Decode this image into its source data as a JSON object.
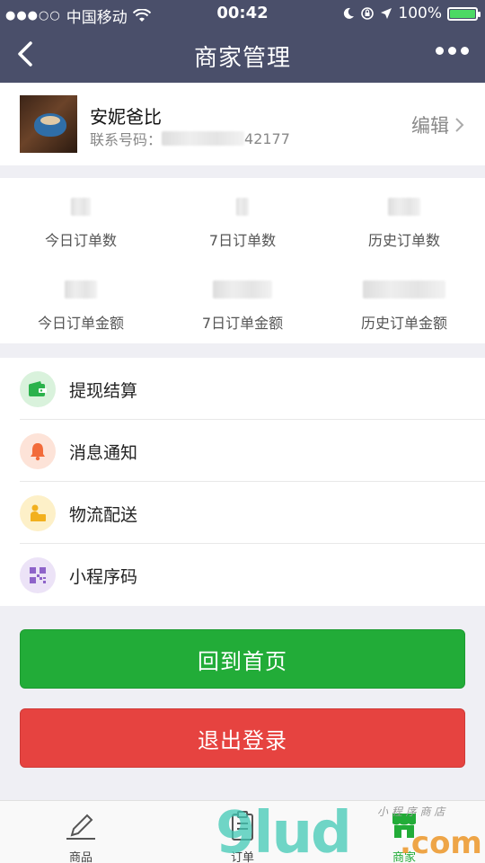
{
  "status_bar": {
    "carrier": "中国移动",
    "time": "00:42",
    "battery": "100%",
    "battery_level": 1.0
  },
  "nav": {
    "title": "商家管理"
  },
  "profile": {
    "name": "安妮爸比",
    "phone_label": "联系号码：",
    "phone_suffix": "42177",
    "edit_label": "编辑"
  },
  "stats": [
    {
      "label": "今日订单数"
    },
    {
      "label": "7日订单数"
    },
    {
      "label": "历史订单数"
    },
    {
      "label": "今日订单金额"
    },
    {
      "label": "7日订单金额"
    },
    {
      "label": "历史订单金额"
    }
  ],
  "menu": [
    {
      "label": "提现结算",
      "icon": "wallet-icon",
      "color": "#2bb24c",
      "bg": "#d9f2dc"
    },
    {
      "label": "消息通知",
      "icon": "bell-icon",
      "color": "#f26b3a",
      "bg": "#fde3d8"
    },
    {
      "label": "物流配送",
      "icon": "delivery-icon",
      "color": "#f2b01e",
      "bg": "#fdf0c8"
    },
    {
      "label": "小程序码",
      "icon": "qrcode-icon",
      "color": "#8e63c9",
      "bg": "#ece3f7"
    }
  ],
  "buttons": {
    "home": "回到首页",
    "logout": "退出登录"
  },
  "tabbar": [
    {
      "label": "商品",
      "icon": "pencil-icon"
    },
    {
      "label": "订单",
      "icon": "clipboard-icon"
    },
    {
      "label": "商家",
      "icon": "store-icon",
      "active": true
    }
  ],
  "watermark": {
    "text": "9lud",
    "domain": ".com",
    "small": "小 程 序 商 店"
  },
  "colors": {
    "nav_bg": "#4a4f6a",
    "primary_green": "#22ac38",
    "danger_red": "#e64340"
  }
}
